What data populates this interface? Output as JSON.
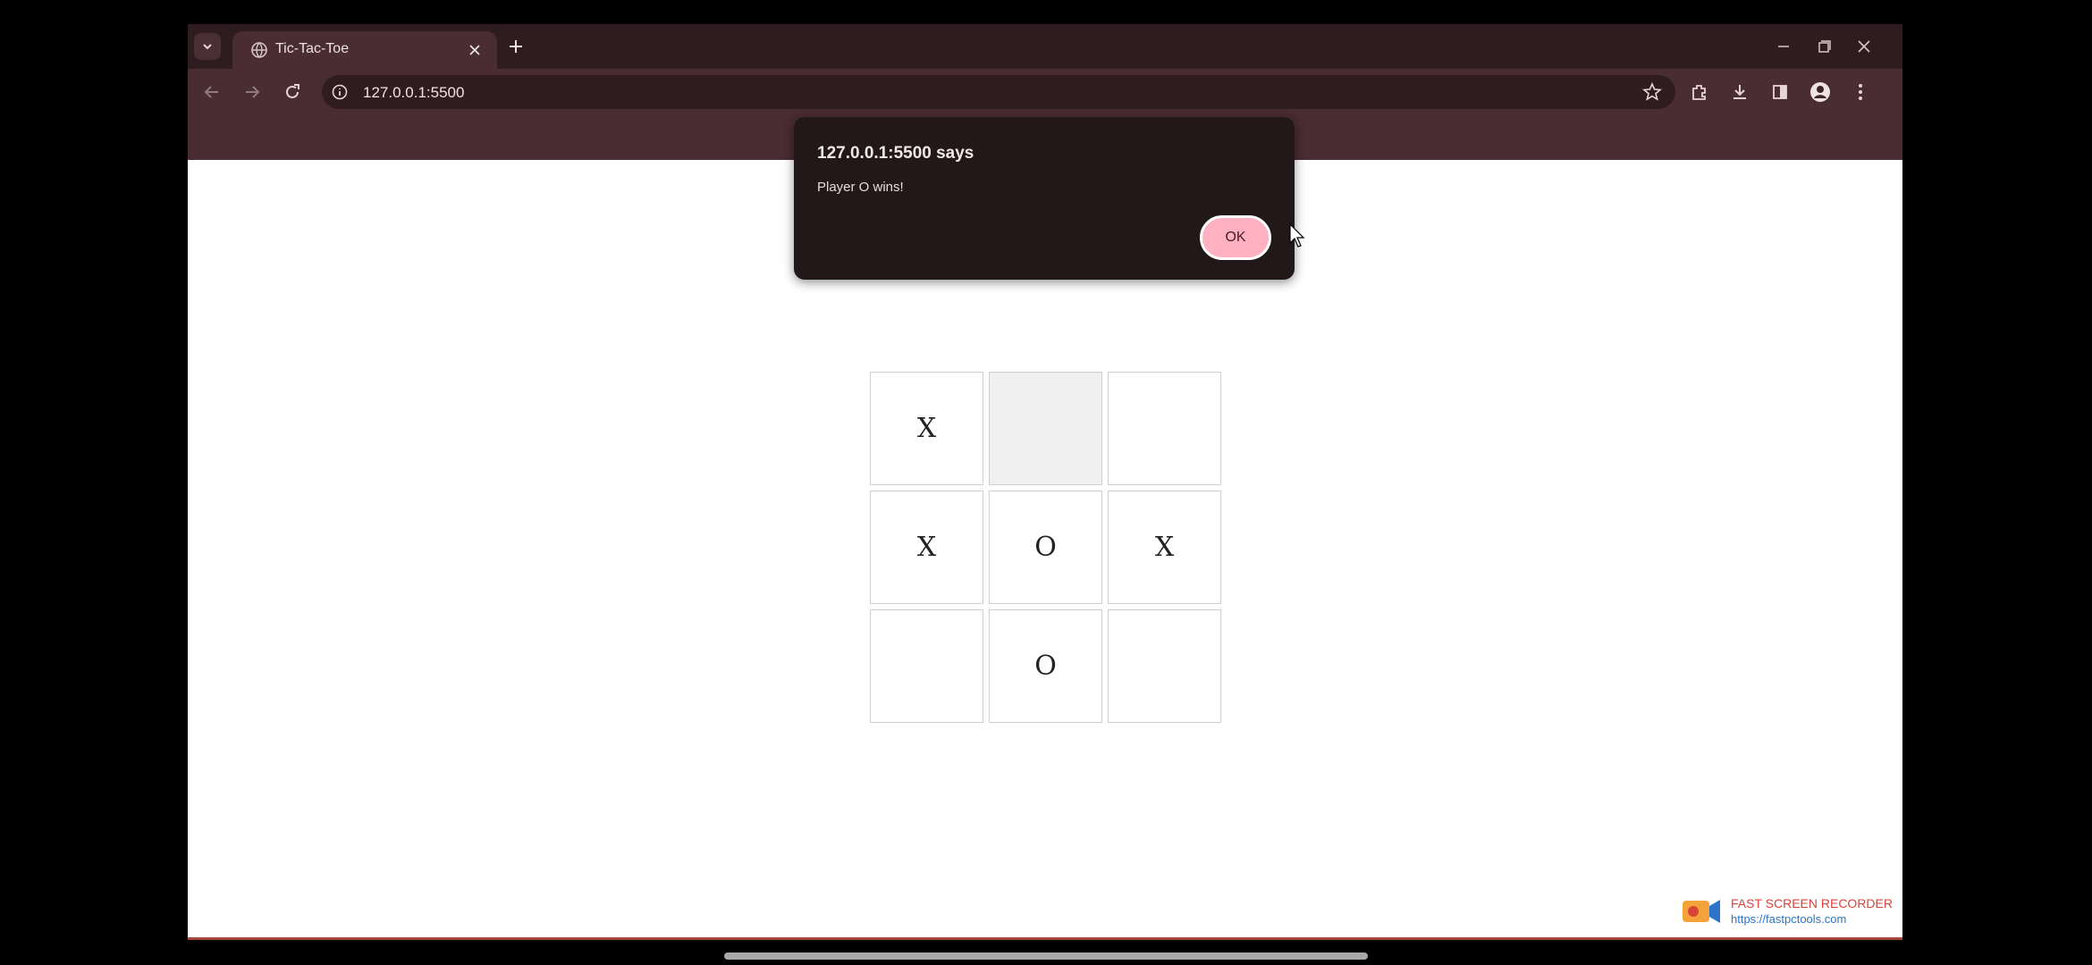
{
  "browser": {
    "tab": {
      "title": "Tic-Tac-Toe"
    },
    "address": {
      "url": "127.0.0.1:5500"
    }
  },
  "page": {
    "board": [
      [
        "X",
        "",
        ""
      ],
      [
        "X",
        "O",
        "X"
      ],
      [
        "",
        "O",
        ""
      ]
    ]
  },
  "dialog": {
    "title": "127.0.0.1:5500 says",
    "message": "Player O wins!",
    "ok_label": "OK"
  },
  "watermark": {
    "title": "FAST SCREEN RECORDER",
    "url": "https://fastpctools.com"
  },
  "colors": {
    "chrome_dark": "#2f1c21",
    "chrome_toolbar": "#4a2c33",
    "dialog_bg": "#221719",
    "ok_button": "#ffb1c1"
  },
  "icons": [
    "tab-search-icon",
    "globe-icon",
    "close-icon",
    "plus-icon",
    "minimize-icon",
    "restore-icon",
    "back-icon",
    "forward-icon",
    "reload-icon",
    "info-icon",
    "star-icon",
    "extensions-icon",
    "download-icon",
    "side-panel-icon",
    "profile-icon",
    "more-icon"
  ]
}
